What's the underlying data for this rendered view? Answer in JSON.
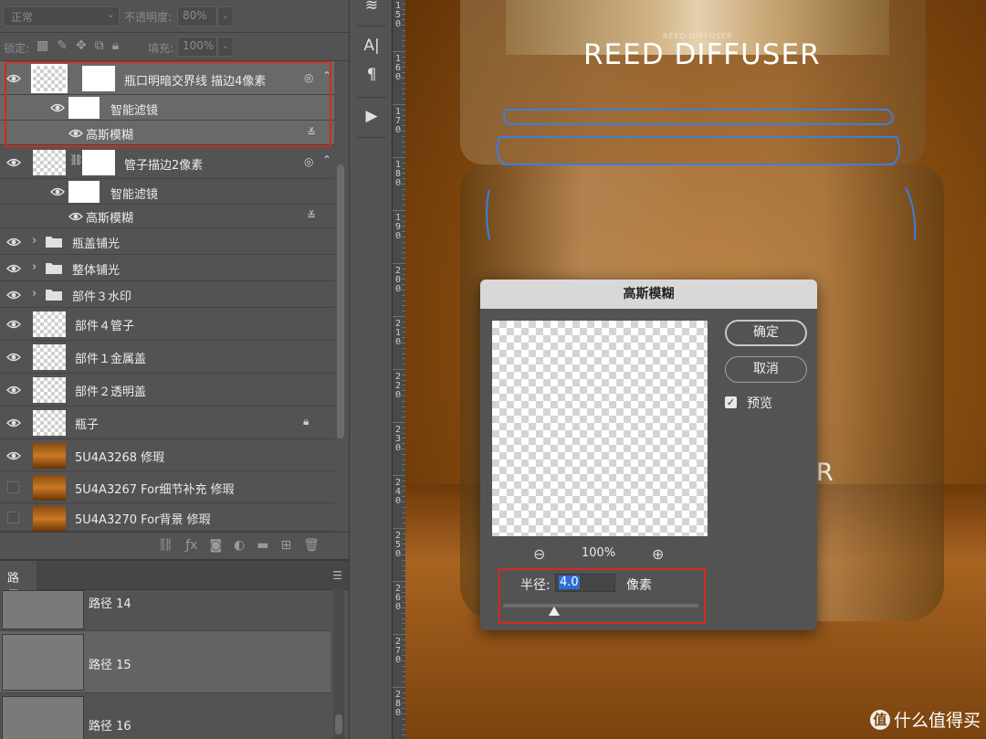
{
  "layers_panel": {
    "blend_mode": "正常",
    "opacity_label": "不透明度:",
    "opacity_value": "80%",
    "lock_label": "锁定:",
    "fill_label": "填充:",
    "fill_value": "100%",
    "layers": [
      {
        "name": "瓶口明暗交界线 描边4像素",
        "visible": true,
        "selected": true
      },
      {
        "name": "智能滤镜",
        "visible": true,
        "sub": true
      },
      {
        "name": "高斯模糊",
        "visible": true,
        "sub": true
      },
      {
        "name": "管子描边2像素",
        "visible": true
      },
      {
        "name": "智能滤镜",
        "visible": true,
        "sub": true
      },
      {
        "name": "高斯模糊",
        "visible": true,
        "sub": true
      },
      {
        "name": "瓶盖铺光",
        "visible": true,
        "group": true
      },
      {
        "name": "整体铺光",
        "visible": true,
        "group": true
      },
      {
        "name": "部件３水印",
        "visible": true,
        "group": true
      },
      {
        "name": "部件４管子",
        "visible": true
      },
      {
        "name": "部件１金属盖",
        "visible": true
      },
      {
        "name": "部件２透明盖",
        "visible": true
      },
      {
        "name": "瓶子",
        "visible": true,
        "locked": true
      },
      {
        "name": "5U4A3268 修瑕",
        "visible": true
      },
      {
        "name": "5U4A3267 For细节补充 修瑕",
        "visible": false
      },
      {
        "name": "5U4A3270 For背景 修瑕",
        "visible": false
      }
    ]
  },
  "paths_panel": {
    "tab": "路径",
    "paths": [
      {
        "name": "路径 14"
      },
      {
        "name": "路径 15",
        "selected": true
      },
      {
        "name": "路径 16"
      }
    ]
  },
  "toolbar": {
    "icons": [
      "adjust-sliders-icon",
      "character-icon",
      "paragraph-icon",
      "play-icon"
    ],
    "character_glyph": "A|",
    "paragraph_glyph": "¶",
    "play_glyph": "▶"
  },
  "ruler": {
    "labels": [
      "150",
      "160",
      "170",
      "180",
      "190",
      "200",
      "210",
      "220",
      "230",
      "240",
      "250",
      "260",
      "270",
      "280"
    ]
  },
  "canvas": {
    "title": "REED DIFFUSER",
    "subtitle": "REED DIFFUSER",
    "letter": "R",
    "watermark": "什么值得买",
    "watermark_badge": "值"
  },
  "dialog": {
    "title": "高斯模糊",
    "ok_label": "确定",
    "cancel_label": "取消",
    "preview_label": "预览",
    "preview_checked": true,
    "zoom_value": "100%",
    "radius_label": "半径:",
    "radius_value": "4.0",
    "radius_unit": "像素",
    "radius_slider_fraction": 0.26
  },
  "colors": {
    "highlight_red": "#d32a1f",
    "selection_blue": "#2b6fd6",
    "panel_bg": "#535353"
  }
}
